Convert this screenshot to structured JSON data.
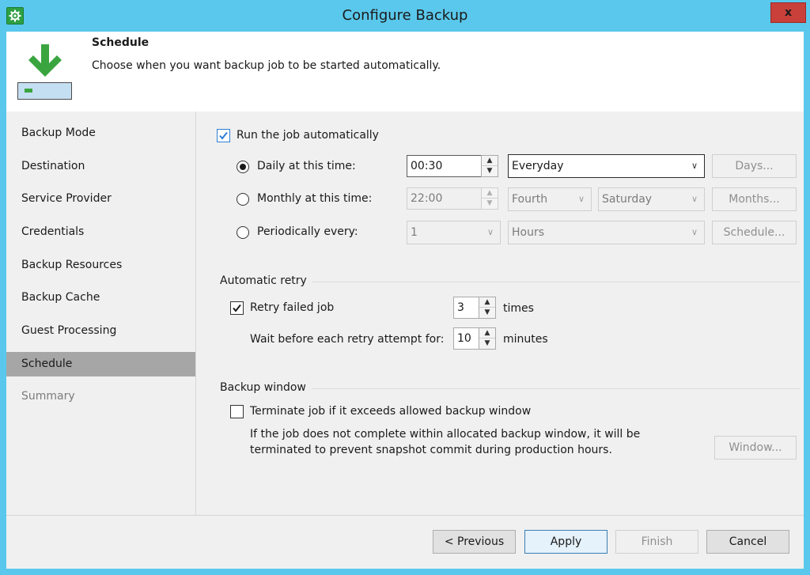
{
  "window": {
    "title": "Configure Backup",
    "close_label": "x"
  },
  "header": {
    "title": "Schedule",
    "description": "Choose when you want backup job to be started automatically."
  },
  "nav": {
    "items": [
      {
        "label": "Backup Mode"
      },
      {
        "label": "Destination"
      },
      {
        "label": "Service Provider"
      },
      {
        "label": "Credentials"
      },
      {
        "label": "Backup Resources"
      },
      {
        "label": "Backup Cache"
      },
      {
        "label": "Guest Processing"
      },
      {
        "label": "Schedule",
        "selected": true
      },
      {
        "label": "Summary",
        "disabled": true
      }
    ]
  },
  "schedule": {
    "run_auto_label": "Run the job automatically",
    "run_auto_checked": true,
    "daily": {
      "label": "Daily at this time:",
      "selected": true,
      "time": "00:30",
      "period": "Everyday",
      "button": "Days..."
    },
    "monthly": {
      "label": "Monthly at this time:",
      "selected": false,
      "time": "22:00",
      "week": "Fourth",
      "day": "Saturday",
      "button": "Months..."
    },
    "periodic": {
      "label": "Periodically every:",
      "selected": false,
      "value": "1",
      "unit": "Hours",
      "button": "Schedule..."
    }
  },
  "retry": {
    "group_label": "Automatic retry",
    "retry_label": "Retry failed job",
    "retry_checked": true,
    "retry_count": "3",
    "times_label": "times",
    "wait_label": "Wait before each retry attempt for:",
    "wait_value": "10",
    "minutes_label": "minutes"
  },
  "backup_window": {
    "group_label": "Backup window",
    "terminate_label": "Terminate job if it exceeds allowed backup window",
    "terminate_checked": false,
    "description_line1": "If the job does not complete within allocated backup window, it will be",
    "description_line2": "terminated to prevent snapshot commit during production hours.",
    "window_button": "Window..."
  },
  "footer": {
    "previous": "< Previous",
    "apply": "Apply",
    "finish": "Finish",
    "cancel": "Cancel"
  },
  "colors": {
    "titlebar": "#5ac8ec",
    "selected_nav": "#a6a6a6",
    "icon_green": "#2ea043",
    "close_red": "#c9403a"
  }
}
